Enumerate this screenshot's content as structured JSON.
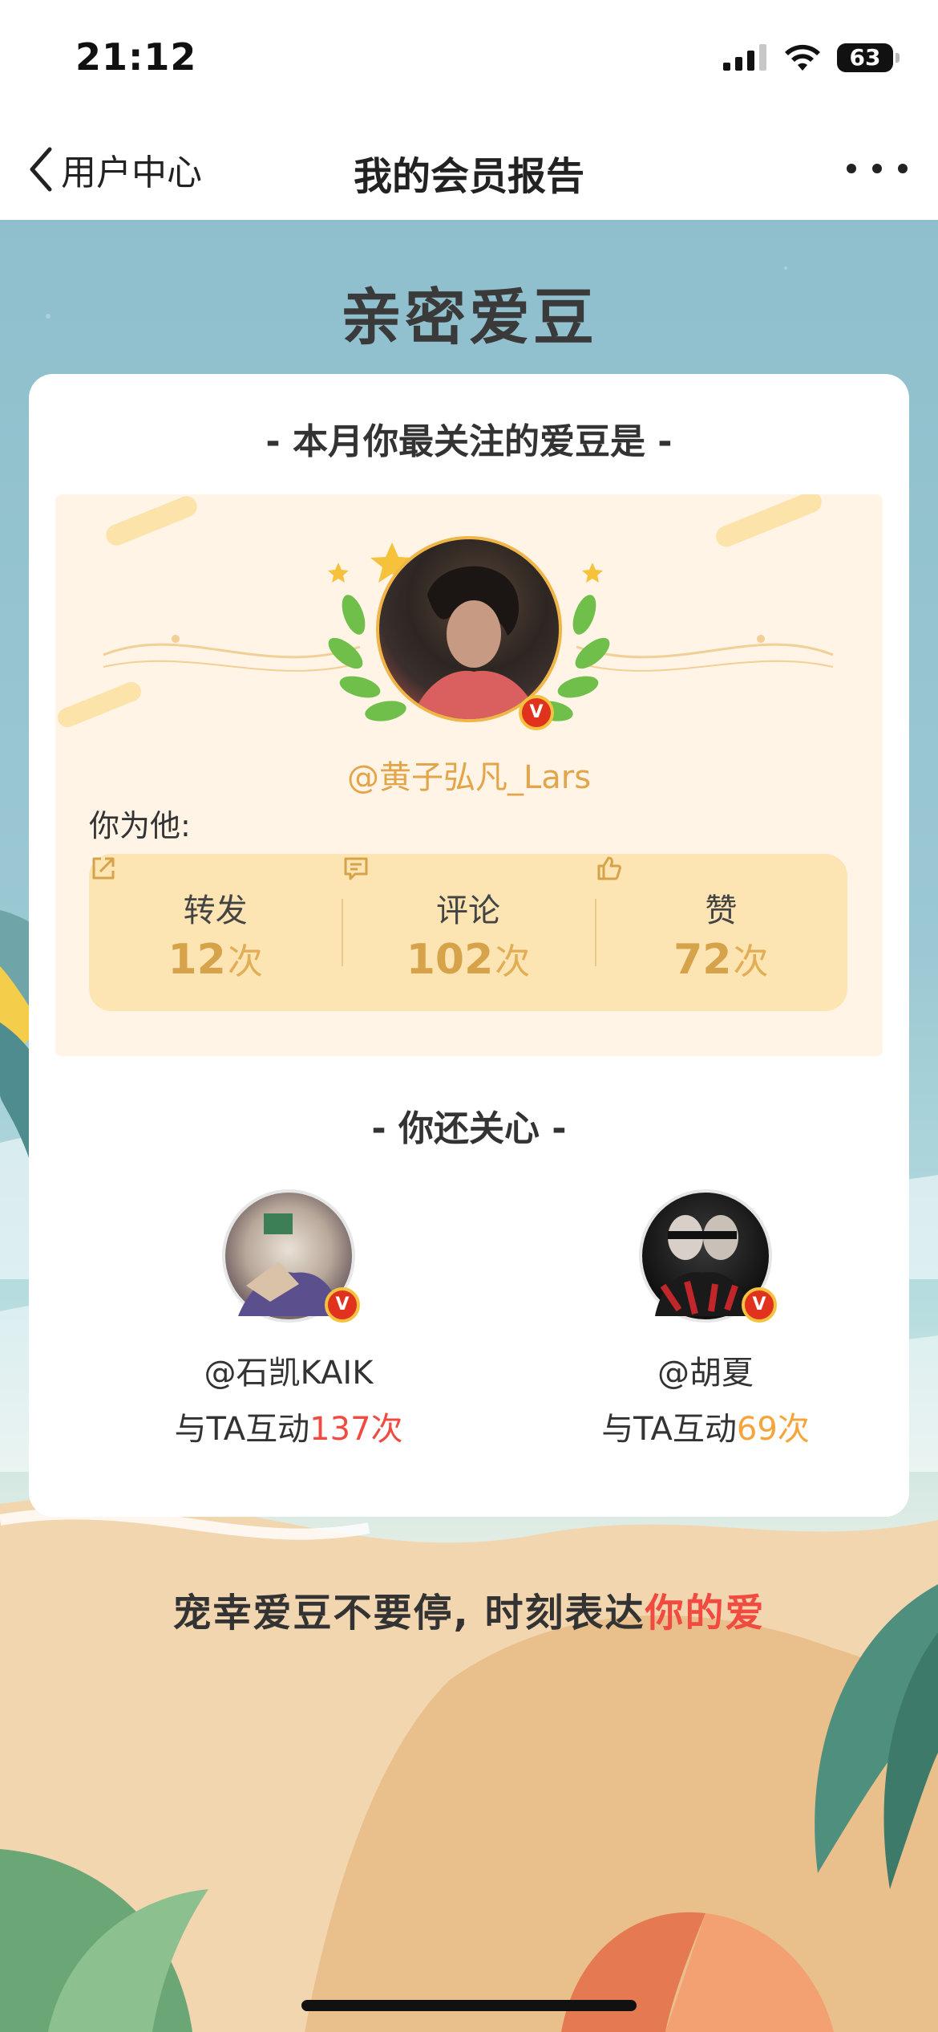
{
  "status_bar": {
    "time": "21:12",
    "battery": "63"
  },
  "nav": {
    "back_label": "用户中心",
    "title": "我的会员报告"
  },
  "page": {
    "section_title": "亲密爱豆"
  },
  "card": {
    "heading": "- 本月你最关注的爱豆是 -",
    "top_idol": {
      "name": "@黄子弘凡_Lars",
      "verify_mark": "V"
    },
    "for_him_label": "你为他:",
    "stats": [
      {
        "icon": "share-icon",
        "label": "转发",
        "value": "12",
        "unit": "次"
      },
      {
        "icon": "comment-icon",
        "label": "评论",
        "value": "102",
        "unit": "次"
      },
      {
        "icon": "like-icon",
        "label": "赞",
        "value": "72",
        "unit": "次"
      }
    ],
    "also_heading": "- 你还关心 -",
    "also_idols": [
      {
        "name": "@石凯KAIK",
        "prefix": "与TA互动",
        "count": "137次",
        "count_color": "#f04a41"
      },
      {
        "name": "@胡夏",
        "prefix": "与TA互动",
        "count": "69次",
        "count_color": "#f5a43a"
      }
    ]
  },
  "slogan": {
    "text": "宠幸爱豆不要停, 时刻表达",
    "highlight": "你的爱"
  },
  "colors": {
    "accent_gold": "#d6a24a",
    "highlight_red": "#f04a41",
    "highlight_orange": "#f5a43a"
  }
}
